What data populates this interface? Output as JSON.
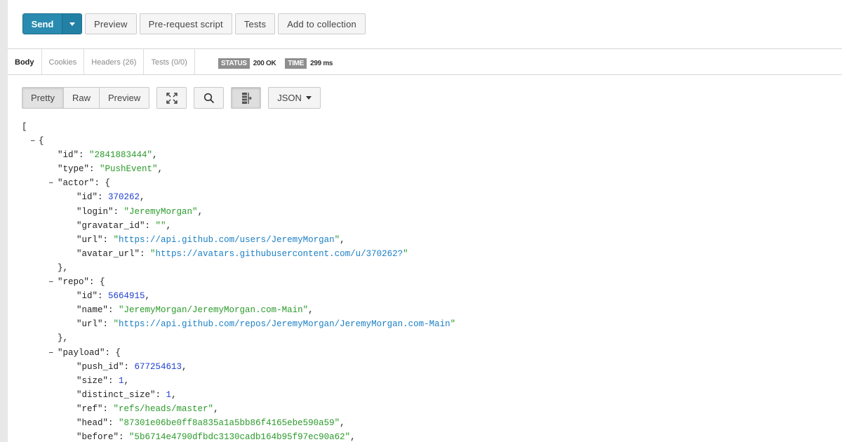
{
  "toolbar": {
    "send_label": "Send",
    "preview_label": "Preview",
    "prerequest_label": "Pre-request script",
    "tests_label": "Tests",
    "add_collection_label": "Add to collection"
  },
  "response_tabs": [
    {
      "label": "Body",
      "active": true
    },
    {
      "label": "Cookies",
      "active": false
    },
    {
      "label": "Headers (26)",
      "active": false
    },
    {
      "label": "Tests (0/0)",
      "active": false
    }
  ],
  "status": {
    "status_label": "STATUS",
    "status_value": "200 OK",
    "time_label": "TIME",
    "time_value": "299 ms"
  },
  "view": {
    "pretty_label": "Pretty",
    "raw_label": "Raw",
    "preview_label": "Preview",
    "expand_icon": "expand-arrows-icon",
    "search_icon": "search-icon",
    "wrap_icon": "wrap-lines-icon",
    "format_label": "JSON"
  },
  "colors": {
    "send": "#2a8bb0",
    "string": "#2a9a2a",
    "number": "#1f3fd0",
    "url": "#1a7fc4"
  },
  "json_lines": [
    {
      "indent": 0,
      "toggle": false,
      "parts": [
        [
          "p",
          "["
        ]
      ]
    },
    {
      "indent": 1,
      "toggle": true,
      "parts": [
        [
          "p",
          "{"
        ]
      ]
    },
    {
      "indent": 2,
      "toggle": false,
      "parts": [
        [
          "k",
          "\"id\""
        ],
        [
          "p",
          ": "
        ],
        [
          "s",
          "\"2841883444\""
        ],
        [
          "p",
          ","
        ]
      ]
    },
    {
      "indent": 2,
      "toggle": false,
      "parts": [
        [
          "k",
          "\"type\""
        ],
        [
          "p",
          ": "
        ],
        [
          "s",
          "\"PushEvent\""
        ],
        [
          "p",
          ","
        ]
      ]
    },
    {
      "indent": 2,
      "toggle": true,
      "parts": [
        [
          "k",
          "\"actor\""
        ],
        [
          "p",
          ": {"
        ]
      ]
    },
    {
      "indent": 3,
      "toggle": false,
      "parts": [
        [
          "k",
          "\"id\""
        ],
        [
          "p",
          ": "
        ],
        [
          "n",
          "370262"
        ],
        [
          "p",
          ","
        ]
      ]
    },
    {
      "indent": 3,
      "toggle": false,
      "parts": [
        [
          "k",
          "\"login\""
        ],
        [
          "p",
          ": "
        ],
        [
          "s",
          "\"JeremyMorgan\""
        ],
        [
          "p",
          ","
        ]
      ]
    },
    {
      "indent": 3,
      "toggle": false,
      "parts": [
        [
          "k",
          "\"gravatar_id\""
        ],
        [
          "p",
          ": "
        ],
        [
          "s",
          "\"\""
        ],
        [
          "p",
          ","
        ]
      ]
    },
    {
      "indent": 3,
      "toggle": false,
      "parts": [
        [
          "k",
          "\"url\""
        ],
        [
          "p",
          ": "
        ],
        [
          "s",
          "\""
        ],
        [
          "u",
          "https://api.github.com/users/JeremyMorgan"
        ],
        [
          "s",
          "\""
        ],
        [
          "p",
          ","
        ]
      ]
    },
    {
      "indent": 3,
      "toggle": false,
      "parts": [
        [
          "k",
          "\"avatar_url\""
        ],
        [
          "p",
          ": "
        ],
        [
          "s",
          "\""
        ],
        [
          "u",
          "https://avatars.githubusercontent.com/u/370262?"
        ],
        [
          "s",
          "\""
        ]
      ]
    },
    {
      "indent": 2,
      "toggle": false,
      "parts": [
        [
          "p",
          "},"
        ]
      ]
    },
    {
      "indent": 2,
      "toggle": true,
      "parts": [
        [
          "k",
          "\"repo\""
        ],
        [
          "p",
          ": {"
        ]
      ]
    },
    {
      "indent": 3,
      "toggle": false,
      "parts": [
        [
          "k",
          "\"id\""
        ],
        [
          "p",
          ": "
        ],
        [
          "n",
          "5664915"
        ],
        [
          "p",
          ","
        ]
      ]
    },
    {
      "indent": 3,
      "toggle": false,
      "parts": [
        [
          "k",
          "\"name\""
        ],
        [
          "p",
          ": "
        ],
        [
          "s",
          "\"JeremyMorgan/JeremyMorgan.com-Main\""
        ],
        [
          "p",
          ","
        ]
      ]
    },
    {
      "indent": 3,
      "toggle": false,
      "parts": [
        [
          "k",
          "\"url\""
        ],
        [
          "p",
          ": "
        ],
        [
          "s",
          "\""
        ],
        [
          "u",
          "https://api.github.com/repos/JeremyMorgan/JeremyMorgan.com-Main"
        ],
        [
          "s",
          "\""
        ]
      ]
    },
    {
      "indent": 2,
      "toggle": false,
      "parts": [
        [
          "p",
          "},"
        ]
      ]
    },
    {
      "indent": 2,
      "toggle": true,
      "parts": [
        [
          "k",
          "\"payload\""
        ],
        [
          "p",
          ": {"
        ]
      ]
    },
    {
      "indent": 3,
      "toggle": false,
      "parts": [
        [
          "k",
          "\"push_id\""
        ],
        [
          "p",
          ": "
        ],
        [
          "n",
          "677254613"
        ],
        [
          "p",
          ","
        ]
      ]
    },
    {
      "indent": 3,
      "toggle": false,
      "parts": [
        [
          "k",
          "\"size\""
        ],
        [
          "p",
          ": "
        ],
        [
          "n",
          "1"
        ],
        [
          "p",
          ","
        ]
      ]
    },
    {
      "indent": 3,
      "toggle": false,
      "parts": [
        [
          "k",
          "\"distinct_size\""
        ],
        [
          "p",
          ": "
        ],
        [
          "n",
          "1"
        ],
        [
          "p",
          ","
        ]
      ]
    },
    {
      "indent": 3,
      "toggle": false,
      "parts": [
        [
          "k",
          "\"ref\""
        ],
        [
          "p",
          ": "
        ],
        [
          "s",
          "\"refs/heads/master\""
        ],
        [
          "p",
          ","
        ]
      ]
    },
    {
      "indent": 3,
      "toggle": false,
      "parts": [
        [
          "k",
          "\"head\""
        ],
        [
          "p",
          ": "
        ],
        [
          "s",
          "\"87301e06be0ff8a835a1a5bb86f4165ebe590a59\""
        ],
        [
          "p",
          ","
        ]
      ]
    },
    {
      "indent": 3,
      "toggle": false,
      "parts": [
        [
          "k",
          "\"before\""
        ],
        [
          "p",
          ": "
        ],
        [
          "s",
          "\"5b6714e4790dfbdc3130cadb164b95f97ec90a62\""
        ],
        [
          "p",
          ","
        ]
      ]
    }
  ]
}
